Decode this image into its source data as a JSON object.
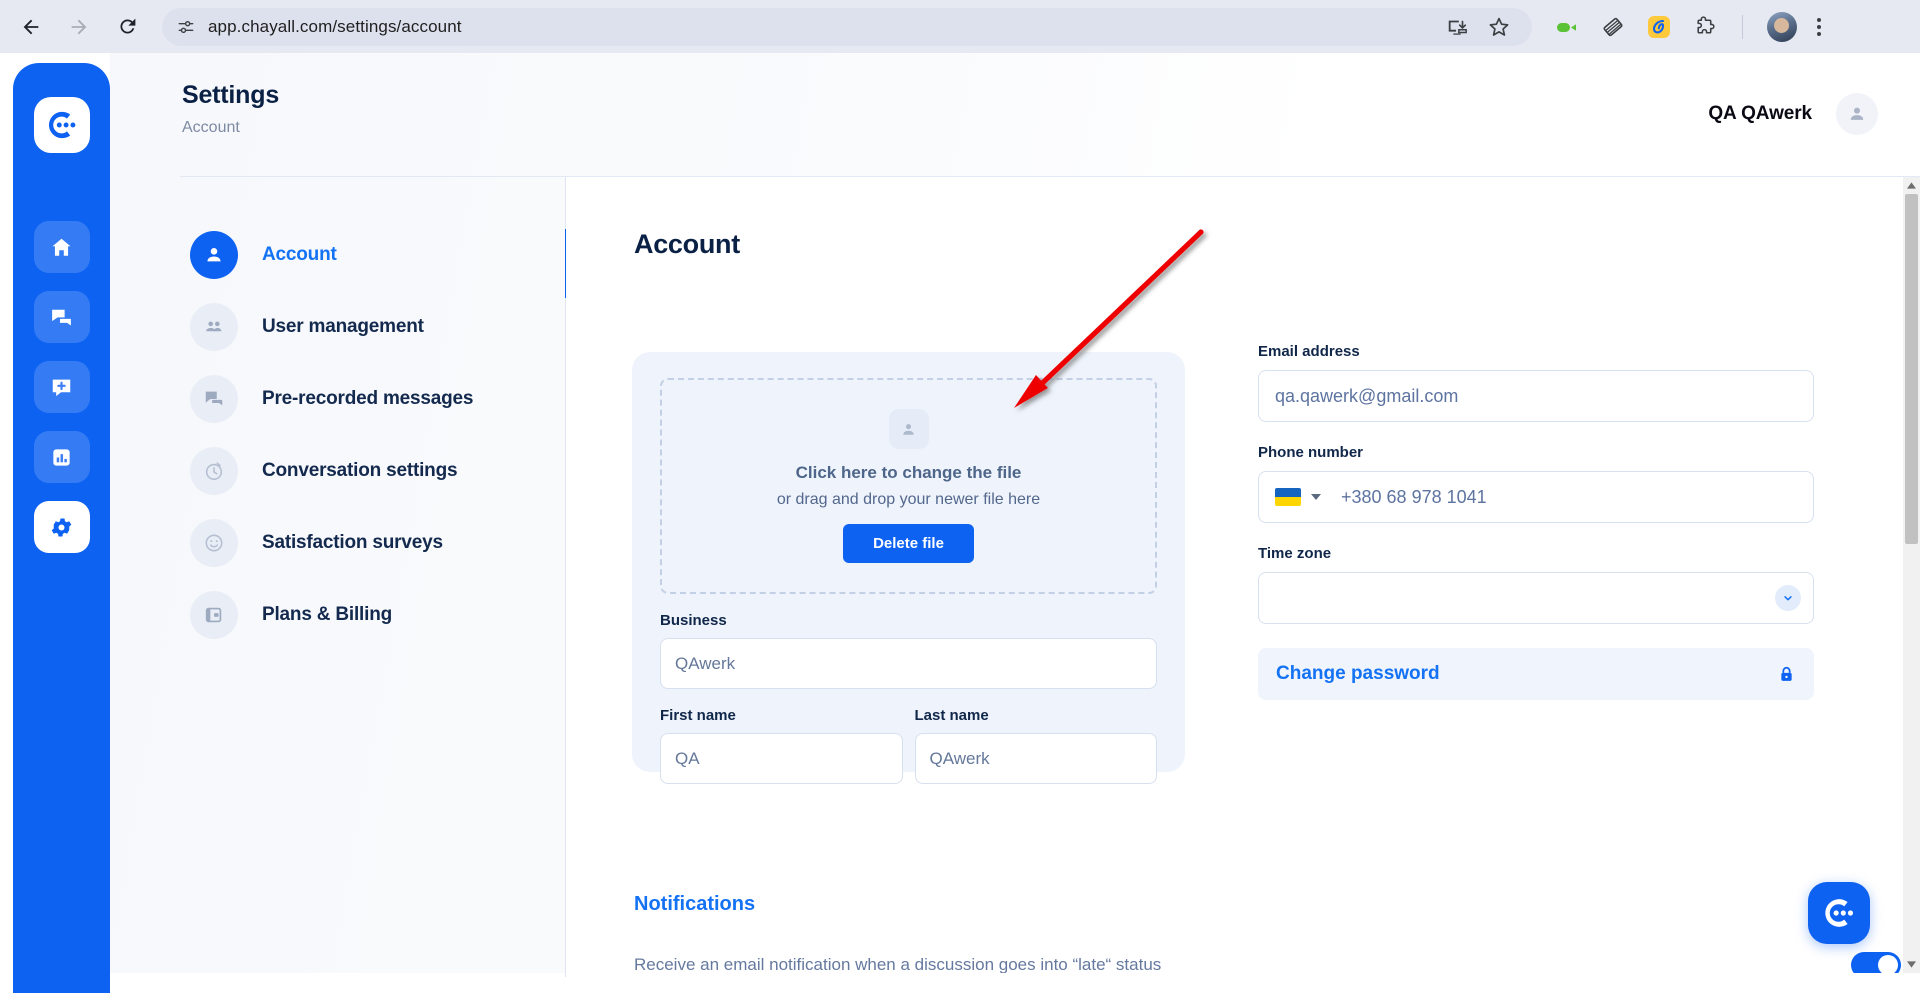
{
  "browser": {
    "url": "app.chayall.com/settings/account",
    "back_label": "Back",
    "forward_label": "Forward",
    "reload_label": "Reload",
    "site_info_icon": "tune-icon",
    "install_icon": "install-app-icon",
    "bookmark_icon": "star-icon",
    "extension_icons": [
      "video-camera-icon",
      "notes-icon",
      "highlighter-icon",
      "puzzle-piece-icon"
    ],
    "profile_icon": "profile-avatar",
    "menu_icon": "kebab-menu-icon"
  },
  "rail": {
    "logo_icon": "chayall-logo-icon",
    "items": [
      {
        "icon": "home-icon",
        "name": "home",
        "active": false
      },
      {
        "icon": "messages-icon",
        "name": "conversations",
        "active": false
      },
      {
        "icon": "new-message-icon",
        "name": "new-message",
        "active": false
      },
      {
        "icon": "bar-chart-icon",
        "name": "statistics",
        "active": false
      },
      {
        "icon": "gear-icon",
        "name": "settings",
        "active": true
      }
    ]
  },
  "header": {
    "title": "Settings",
    "subtitle": "Account",
    "user_name": "QA QAwerk",
    "user_avatar_icon": "person-icon"
  },
  "settings_nav": {
    "items": [
      {
        "label": "Account",
        "icon": "person-icon",
        "active": true
      },
      {
        "label": "User management",
        "icon": "people-icon",
        "active": false
      },
      {
        "label": "Pre-recorded messages",
        "icon": "chat-bubbles-icon",
        "active": false
      },
      {
        "label": "Conversation settings",
        "icon": "timer-icon",
        "active": false
      },
      {
        "label": "Satisfaction surveys",
        "icon": "smiley-icon",
        "active": false
      },
      {
        "label": "Plans & Billing",
        "icon": "wallet-icon",
        "active": false
      }
    ]
  },
  "account": {
    "page_title": "Account",
    "dropzone": {
      "avatar_icon": "person-icon",
      "title": "Click here to change the file",
      "subtitle": "or drag and drop your newer file here",
      "delete_button": "Delete file"
    },
    "business": {
      "label": "Business",
      "value": "QAwerk"
    },
    "first_name": {
      "label": "First name",
      "value": "QA"
    },
    "last_name": {
      "label": "Last name",
      "value": "QAwerk"
    },
    "email": {
      "label": "Email address",
      "value": "qa.qawerk@gmail.com"
    },
    "phone": {
      "label": "Phone number",
      "country_flag": "ukraine-flag",
      "value": "+380 68 978 1041"
    },
    "timezone": {
      "label": "Time zone",
      "value": "",
      "caret_icon": "chevron-down-icon"
    },
    "change_password": {
      "label": "Change password",
      "icon": "lock-icon"
    }
  },
  "notifications": {
    "title": "Notifications",
    "row_text": "Receive an email notification when a discussion goes into “late“ status",
    "toggle_on": true
  },
  "chat_widget": {
    "icon": "chayall-logo-icon"
  },
  "scrollbar": {
    "up_icon": "scroll-up-arrow",
    "down_icon": "scroll-down-arrow"
  },
  "annotation": {
    "arrow_color": "#ee0000",
    "type": "arrow-pointing-to-dropzone"
  },
  "colors": {
    "brand_blue": "#0d62f2",
    "link_blue": "#1472f5",
    "dark_navy": "#0a2145",
    "card_bg": "#eef3fc",
    "annotation_red": "#ee0000"
  }
}
